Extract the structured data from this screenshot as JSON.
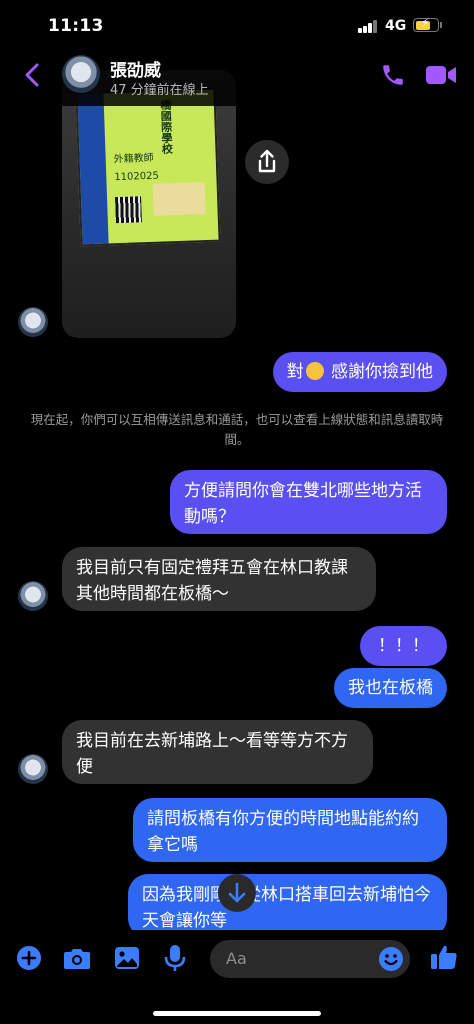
{
  "status": {
    "time": "11:13",
    "network": "4G"
  },
  "header": {
    "name": "張劭威",
    "presence": "47 分鐘前在線上"
  },
  "photo_card": {
    "lines": [
      "外籍教師",
      "橋國際學校",
      "1102025"
    ]
  },
  "notice": "現在起，你們可以互相傳送訊息和通話，也可以查看上線狀態和訊息讀取時間。",
  "messages": {
    "m1_before": "對",
    "m1_after": " 感謝你撿到他",
    "m2": "方便請問你會在雙北哪些地方活動嗎？",
    "m3": "我目前只有固定禮拜五會在林口教課 其他時間都在板橋～",
    "m4": "！！！",
    "m5": "我也在板橋",
    "m6": "我目前在去新埔路上～看等等方不方便",
    "m7": "請問板橋有你方便的時間地點能約約拿它嗎",
    "m8": "因為我剛剛也從林口搭車回去新埔怕今天會讓你等"
  },
  "composer": {
    "placeholder": "Aa"
  },
  "colors": {
    "accent": "#a259ff",
    "outgoing_top": "#5a4ff0",
    "outgoing_bottom": "#2f66f2",
    "incoming": "#323232",
    "icon_blue": "#3b7dff"
  }
}
